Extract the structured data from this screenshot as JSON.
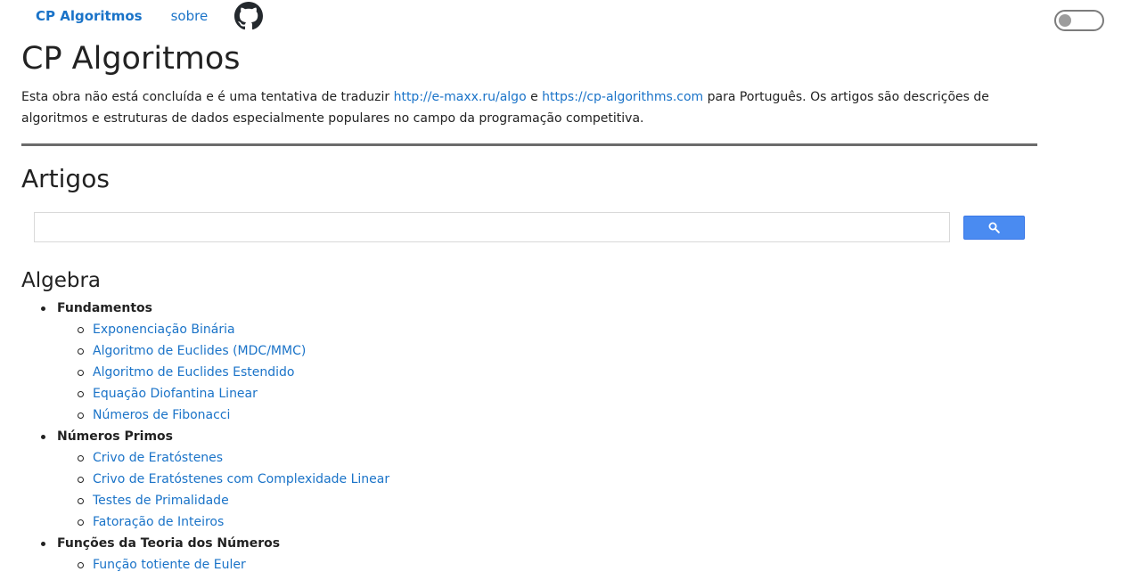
{
  "nav": {
    "brand": "CP Algoritmos",
    "about": "sobre",
    "github_icon": "github-icon"
  },
  "theme_toggle": {
    "state": "off"
  },
  "page": {
    "title": "CP Algoritmos",
    "intro_before": "Esta obra não está concluída e é uma tentativa de traduzir ",
    "link1": "http://e-maxx.ru/algo",
    "intro_mid": " e ",
    "link2": "https://cp-algorithms.com",
    "intro_after": " para Português. Os artigos são descrições de algoritmos e estruturas de dados especialmente populares no campo da programação competitiva."
  },
  "articles": {
    "heading": "Artigos",
    "search": {
      "value": "",
      "button_icon": "search-icon"
    }
  },
  "colors": {
    "link": "#1a73c8",
    "search_button": "#4a8bf1",
    "divider": "#6b6b6b"
  },
  "algebra": {
    "heading": "Algebra",
    "groups": [
      {
        "title": "Fundamentos",
        "items": [
          "Exponenciação Binária",
          "Algoritmo de Euclides (MDC/MMC)",
          "Algoritmo de Euclides Estendido",
          "Equação Diofantina Linear",
          "Números de Fibonacci"
        ]
      },
      {
        "title": "Números Primos",
        "items": [
          "Crivo de Eratóstenes",
          "Crivo de Eratóstenes com Complexidade Linear",
          "Testes de Primalidade",
          "Fatoração de Inteiros"
        ]
      },
      {
        "title": "Funções da Teoria dos Números",
        "items": [
          "Função totiente de Euler"
        ]
      }
    ]
  }
}
